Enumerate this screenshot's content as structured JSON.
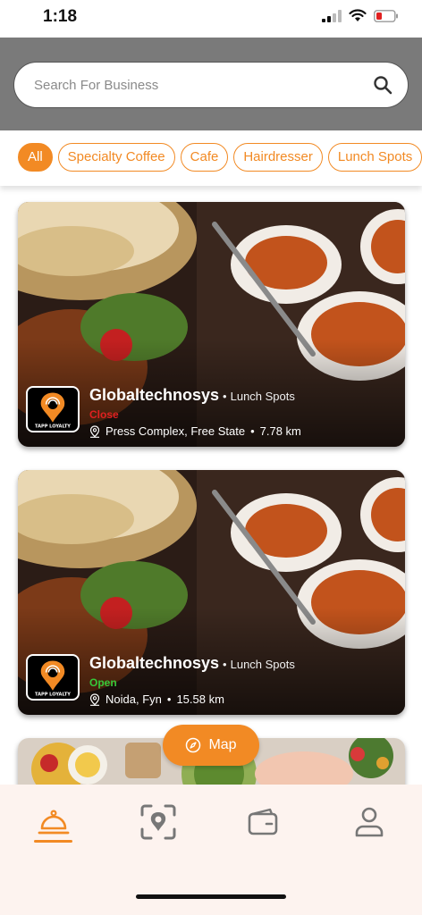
{
  "status_bar": {
    "time": "1:18"
  },
  "search": {
    "placeholder": "Search For Business",
    "value": ""
  },
  "categories": [
    {
      "label": "All",
      "active": true
    },
    {
      "label": "Specialty Coffee",
      "active": false
    },
    {
      "label": "Cafe",
      "active": false
    },
    {
      "label": "Hairdresser",
      "active": false
    },
    {
      "label": "Lunch Spots",
      "active": false
    }
  ],
  "listings": [
    {
      "name": "Globaltechnosys",
      "category_sep": "•",
      "category": "Lunch Spots",
      "status": "Close",
      "location": "Press Complex, Free State",
      "distance": "7.78 km",
      "logo_text": "TAPP LOYALTY"
    },
    {
      "name": "Globaltechnosys",
      "category_sep": "•",
      "category": "Lunch Spots",
      "status": "Open",
      "location": "Noida, Fyn",
      "distance": "15.58 km",
      "logo_text": "TAPP LOYALTY"
    }
  ],
  "map_button": {
    "label": "Map",
    "icon": "compass-icon"
  },
  "bottom_nav": [
    {
      "icon": "service-bell-icon",
      "active": true
    },
    {
      "icon": "scan-icon",
      "active": false
    },
    {
      "icon": "wallet-icon",
      "active": false
    },
    {
      "icon": "profile-icon",
      "active": false
    }
  ],
  "colors": {
    "accent": "#f28a24",
    "status_close": "#e02020",
    "status_open": "#36c93a",
    "nav_bg": "#fdf3ef",
    "header_bg": "#7a7a7a"
  }
}
